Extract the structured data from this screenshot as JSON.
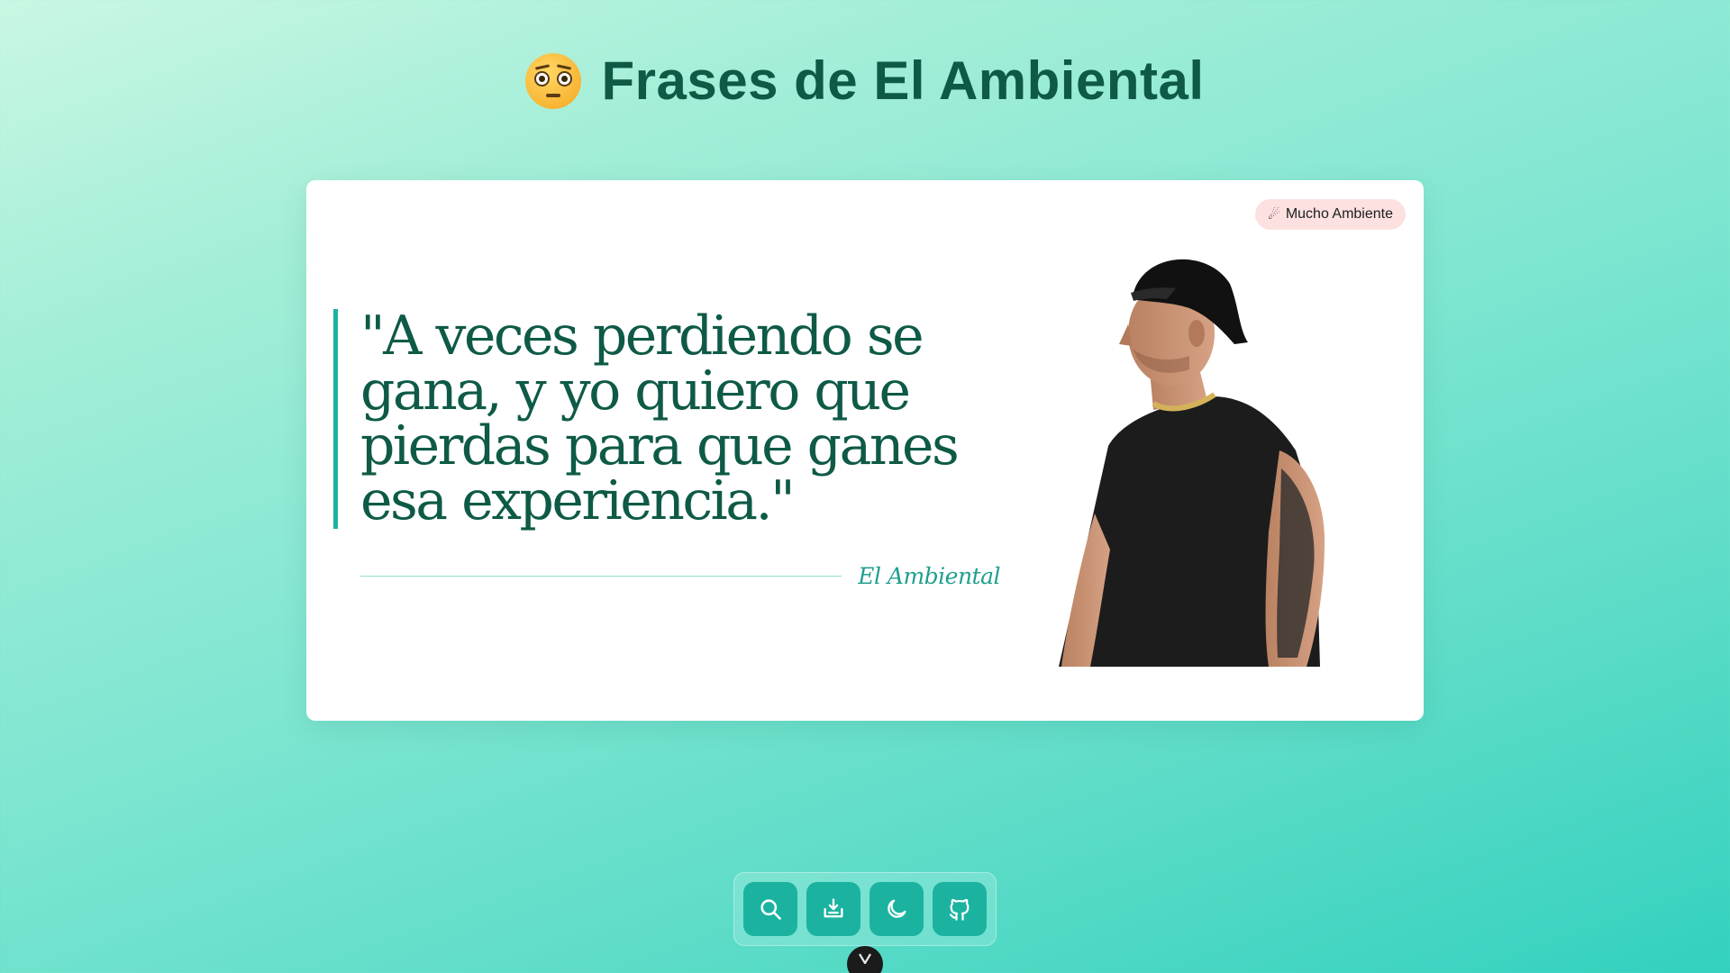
{
  "header": {
    "emoji": "face-with-raised-eyebrows-emoji",
    "title": "Frases de El Ambiental"
  },
  "card": {
    "badge": {
      "icon": "comet-icon",
      "label": "Mucho Ambiente"
    },
    "quote": "\"A veces perdiendo se gana, y yo quiero que pierdas para que ganes esa experiencia.\"",
    "author": "El Ambiental",
    "image": "el-ambiental-photo"
  },
  "toolbar": {
    "buttons": [
      {
        "icon": "search-icon"
      },
      {
        "icon": "download-icon"
      },
      {
        "icon": "moon-icon"
      },
      {
        "icon": "github-icon"
      }
    ]
  },
  "colors": {
    "title": "#0e5a47",
    "accent": "#1bb3a0",
    "badge_bg": "#fde1e1",
    "card_bg": "#ffffff"
  }
}
